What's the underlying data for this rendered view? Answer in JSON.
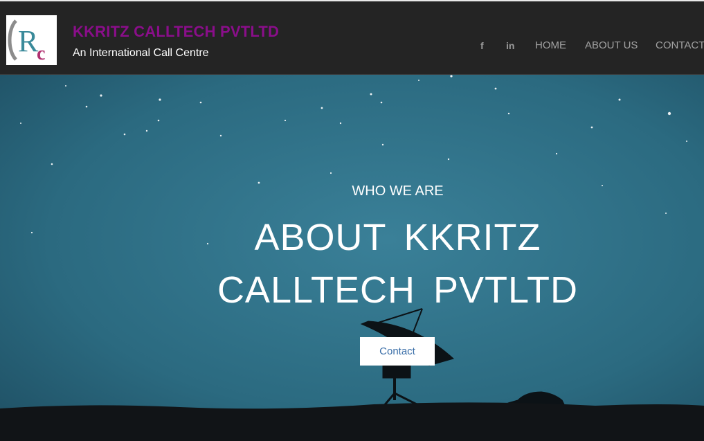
{
  "brand": {
    "logo_text": "Rc",
    "name": "KKRITZ CALLTECH PVTLTD",
    "tagline": "An International Call Centre",
    "color": "#8a0e8a"
  },
  "nav": {
    "social": [
      {
        "icon": "facebook-icon",
        "glyph": "f"
      },
      {
        "icon": "linkedin-icon",
        "glyph": "in"
      }
    ],
    "links": [
      "HOME",
      "ABOUT US",
      "CONTACT"
    ]
  },
  "hero": {
    "kicker": "WHO WE ARE",
    "title_line1": "ABOUT KKRITZ",
    "title_line2": "CALLTECH PVTLTD",
    "cta_label": "Contact",
    "sky_color": "#2e6f86"
  }
}
